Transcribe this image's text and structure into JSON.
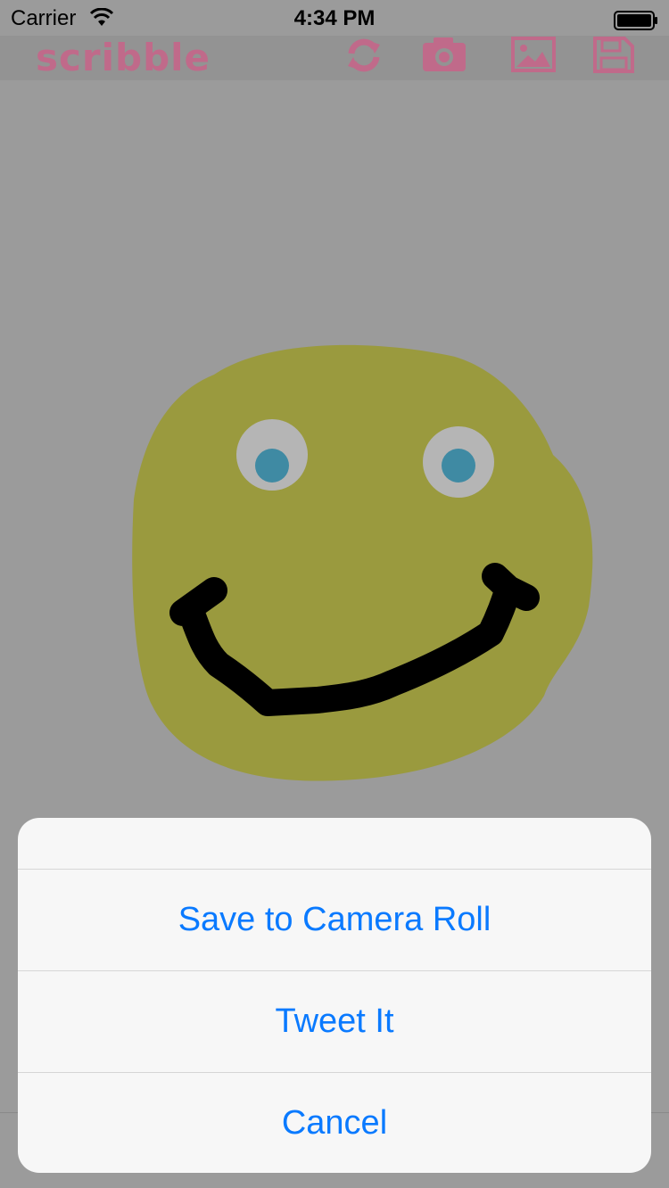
{
  "status_bar": {
    "carrier": "Carrier",
    "time": "4:34 PM"
  },
  "toolbar": {
    "logo": "scribble",
    "icons": [
      "refresh-icon",
      "camera-icon",
      "image-icon",
      "save-icon"
    ],
    "accent_color": "#c06a8a"
  },
  "drawing": {
    "face_color": "#9a9a3e",
    "eye_white": "#b5b5b5",
    "pupil_color": "#3f8aa3",
    "mouth_color": "#000000"
  },
  "action_sheet": {
    "buttons": {
      "save": "Save to Camera Roll",
      "tweet": "Tweet It",
      "cancel": "Cancel"
    },
    "button_color": "#0a7aff"
  }
}
